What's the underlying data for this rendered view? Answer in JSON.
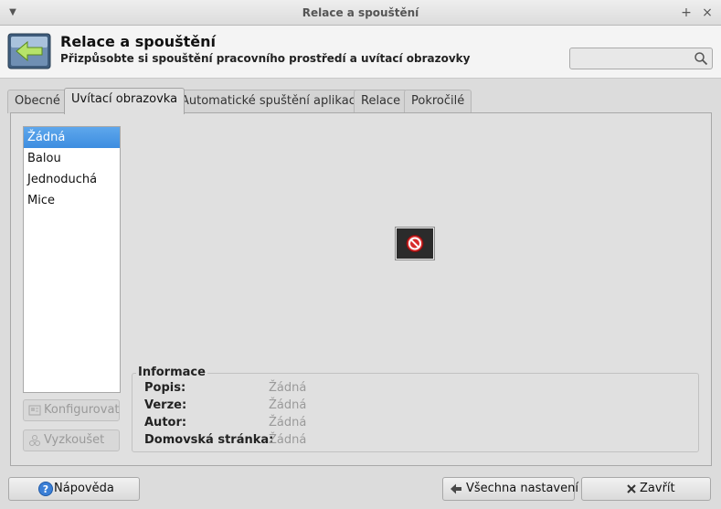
{
  "window": {
    "title": "Relace a spouštění",
    "maximize_symbol": "+",
    "close_symbol": "×"
  },
  "header": {
    "title": "Relace a spouštění",
    "subtitle": "Přizpůsobte si spouštění pracovního prostředí a uvítací obrazovky",
    "icon": "session-arrow-icon",
    "search": {
      "value": "",
      "placeholder": ""
    }
  },
  "tabs": [
    {
      "label": "Obecné",
      "active": false
    },
    {
      "label": "Uvítací obrazovka",
      "active": true
    },
    {
      "label": "Automatické spuštění aplikace",
      "active": false
    },
    {
      "label": "Relace",
      "active": false
    },
    {
      "label": "Pokročilé",
      "active": false
    }
  ],
  "splash_list": {
    "items": [
      "Žádná",
      "Balou",
      "Jednoduchá",
      "Mice"
    ],
    "selected_index": 0
  },
  "side_buttons": {
    "configure": "Konfigurovat",
    "test": "Vyzkoušet"
  },
  "preview": {
    "icon": "no-preview-icon"
  },
  "info": {
    "legend": "Informace",
    "rows": [
      {
        "label": "Popis:",
        "value": "Žádná"
      },
      {
        "label": "Verze:",
        "value": "Žádná"
      },
      {
        "label": "Autor:",
        "value": "Žádná"
      },
      {
        "label": "Domovská stránka:",
        "value": "Žádná"
      }
    ]
  },
  "footer": {
    "help": "Nápověda",
    "all_settings": "Všechna nastavení",
    "close": "Zavřít"
  },
  "colors": {
    "selection": "#4a97e6",
    "window_bg": "#dcdcdc",
    "disabled_text": "#9a9a9a"
  }
}
